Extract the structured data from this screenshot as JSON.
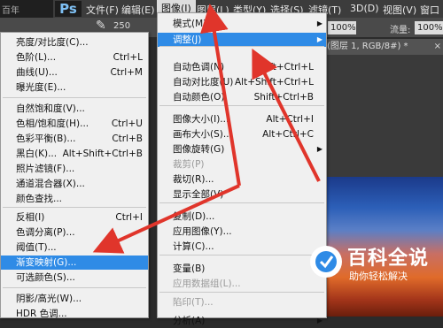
{
  "menubar": {
    "logo": "Ps",
    "items": [
      "文件(F)",
      "编辑(E)",
      "图像(I)",
      "图层(L)",
      "类型(Y)",
      "选择(S)",
      "滤镜(T)",
      "3D(D)",
      "视图(V)",
      "窗口"
    ],
    "left_label": "百年"
  },
  "options": {
    "size": "250",
    "opacity_value": "100%",
    "flow_label": "流量:",
    "flow_value": "100%"
  },
  "document": {
    "tab": "(图层 1, RGB/8#) *",
    "close": "×"
  },
  "image_menu": {
    "items": [
      {
        "label": "模式(M)",
        "shortcut": "",
        "submenu": true,
        "disabled": false
      },
      {
        "label": "调整(J)",
        "shortcut": "",
        "submenu": true,
        "disabled": false,
        "highlight": true
      },
      {
        "label": "自动色调(N)",
        "shortcut": "Shift+Ctrl+L",
        "disabled": false
      },
      {
        "label": "自动对比度(U)",
        "shortcut": "Alt+Shift+Ctrl+L",
        "disabled": false
      },
      {
        "label": "自动颜色(O)",
        "shortcut": "Shift+Ctrl+B",
        "disabled": false
      },
      {
        "label": "图像大小(I)...",
        "shortcut": "Alt+Ctrl+I",
        "disabled": false
      },
      {
        "label": "画布大小(S)...",
        "shortcut": "Alt+Ctrl+C",
        "disabled": false
      },
      {
        "label": "图像旋转(G)",
        "shortcut": "",
        "submenu": true,
        "disabled": false
      },
      {
        "label": "裁剪(P)",
        "shortcut": "",
        "disabled": true
      },
      {
        "label": "裁切(R)...",
        "shortcut": "",
        "disabled": false
      },
      {
        "label": "显示全部(V)",
        "shortcut": "",
        "disabled": false
      },
      {
        "label": "复制(D)...",
        "shortcut": "",
        "disabled": false
      },
      {
        "label": "应用图像(Y)...",
        "shortcut": "",
        "disabled": false
      },
      {
        "label": "计算(C)...",
        "shortcut": "",
        "disabled": false
      },
      {
        "label": "变量(B)",
        "shortcut": "",
        "submenu": true,
        "disabled": false
      },
      {
        "label": "应用数据组(L)...",
        "shortcut": "",
        "disabled": true
      },
      {
        "label": "陷印(T)...",
        "shortcut": "",
        "disabled": true
      },
      {
        "label": "分析(A)",
        "shortcut": "",
        "submenu": true,
        "disabled": false
      }
    ]
  },
  "adjust_menu": {
    "items": [
      {
        "label": "亮度/对比度(C)...",
        "shortcut": ""
      },
      {
        "label": "色阶(L)...",
        "shortcut": "Ctrl+L"
      },
      {
        "label": "曲线(U)...",
        "shortcut": "Ctrl+M"
      },
      {
        "label": "曝光度(E)...",
        "shortcut": ""
      },
      {
        "label": "自然饱和度(V)...",
        "shortcut": ""
      },
      {
        "label": "色相/饱和度(H)...",
        "shortcut": "Ctrl+U"
      },
      {
        "label": "色彩平衡(B)...",
        "shortcut": "Ctrl+B"
      },
      {
        "label": "黑白(K)...",
        "shortcut": "Alt+Shift+Ctrl+B"
      },
      {
        "label": "照片滤镜(F)...",
        "shortcut": ""
      },
      {
        "label": "通道混合器(X)...",
        "shortcut": ""
      },
      {
        "label": "颜色查找...",
        "shortcut": ""
      },
      {
        "label": "反相(I)",
        "shortcut": "Ctrl+I"
      },
      {
        "label": "色调分离(P)...",
        "shortcut": ""
      },
      {
        "label": "阈值(T)...",
        "shortcut": ""
      },
      {
        "label": "渐变映射(G)...",
        "shortcut": "",
        "highlight": true
      },
      {
        "label": "可选颜色(S)...",
        "shortcut": ""
      },
      {
        "label": "阴影/高光(W)...",
        "shortcut": ""
      },
      {
        "label": "HDR 色调...",
        "shortcut": ""
      }
    ]
  },
  "watermark": {
    "title": "百科全说",
    "subtitle": "助你轻松解决"
  },
  "colors": {
    "highlight": "#2f8be6",
    "arrow": "#e0352b"
  }
}
